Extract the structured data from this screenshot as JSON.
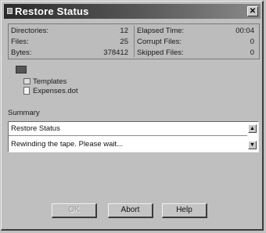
{
  "window": {
    "title": "Restore Status"
  },
  "stats": {
    "left": [
      {
        "label": "Directories:",
        "value": "12"
      },
      {
        "label": "Files:",
        "value": "25"
      },
      {
        "label": "Bytes:",
        "value": "378412"
      }
    ],
    "right": [
      {
        "label": "Elapsed Time:",
        "value": "00:04"
      },
      {
        "label": "Corrupt Files:",
        "value": "0"
      },
      {
        "label": "Skipped Files:",
        "value": "0"
      }
    ]
  },
  "tree": {
    "items": [
      {
        "label": "Templates",
        "icon": "folder-icon"
      },
      {
        "label": "Expenses.dot",
        "icon": "file-icon"
      }
    ]
  },
  "summary": {
    "label": "Summary",
    "lines": [
      "Restore Status",
      "Rewinding the tape. Please wait..."
    ]
  },
  "buttons": {
    "ok": "OK",
    "abort": "Abort",
    "help": "Help"
  },
  "colors": {
    "titlebar_start": "#2a2a2a",
    "titlebar_end": "#8a8a8a",
    "face": "#bfbfbf"
  }
}
